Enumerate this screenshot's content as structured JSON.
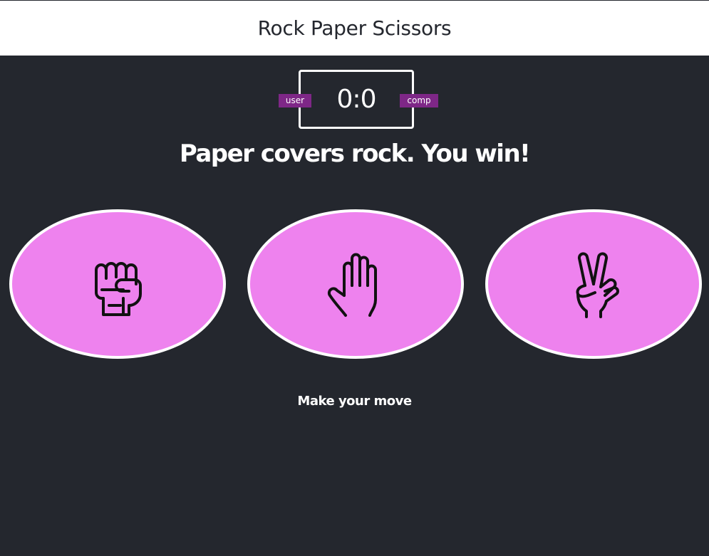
{
  "header": {
    "title": "Rock Paper Scissors"
  },
  "scoreboard": {
    "user_label": "user",
    "comp_label": "comp",
    "score": "0:0"
  },
  "result": {
    "message": "Paper covers rock. You win!"
  },
  "choices": [
    {
      "id": "rock",
      "icon": "fist-icon"
    },
    {
      "id": "paper",
      "icon": "open-hand-icon"
    },
    {
      "id": "scissors",
      "icon": "peace-hand-icon"
    }
  ],
  "action": {
    "prompt": "Make your move"
  },
  "colors": {
    "background": "#24272e",
    "header_background": "#ffffff",
    "choice_fill": "#ee82ee",
    "badge": "#7e2787",
    "text": "#ffffff"
  }
}
